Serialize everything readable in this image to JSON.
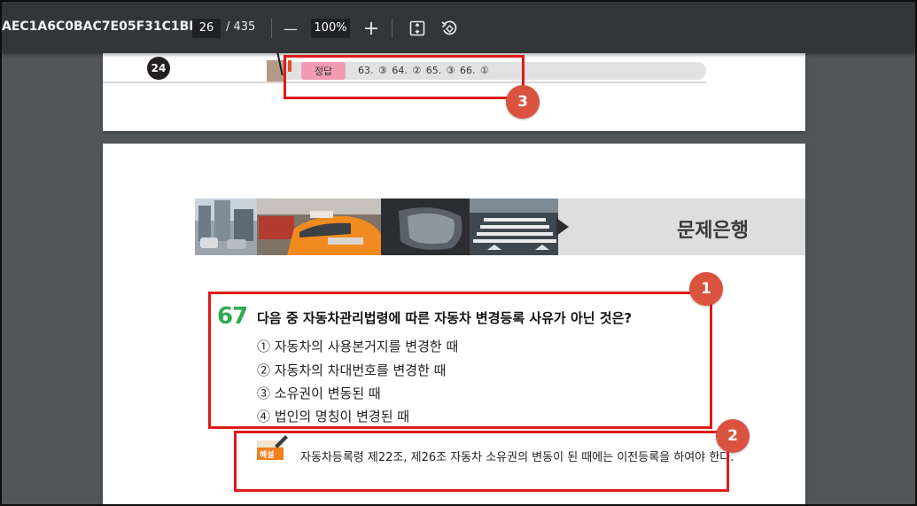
{
  "toolbar": {
    "doc_title": "AEC1A6C0BAC7E05F31C1BE...",
    "page_current": "26",
    "page_total": "/ 435",
    "zoom": "100%",
    "zoom_out_symbol": "—",
    "zoom_in_symbol": "+",
    "icons": [
      "fit-page-icon",
      "rotate-icon"
    ]
  },
  "prev_page": {
    "page_number": "24",
    "answer_label": "정답",
    "answers": "63. ③   64. ②   65. ③   66. ①"
  },
  "current_page": {
    "section_title": "문제은행",
    "question_number": "67",
    "question_text": "다음 중 자동차관리법령에 따른 자동차 변경등록 사유가 아닌 것은?",
    "options": [
      "① 자동차의 사용본거지를 변경한 때",
      "② 자동차의 차대번호를 변경한 때",
      "③ 소유권이 변동된 때",
      "④ 법인의 명칭이 변경된 때"
    ],
    "solution_badge": "해설",
    "solution_text": "자동차등록령 제22조, 제26조 자동차 소유권의 변동이 된 때에는 이전등록을 하여야 한다."
  },
  "annotations": {
    "labels": [
      "1",
      "2",
      "3"
    ],
    "box_color": "#e01a1a",
    "badge_color": "#d9533f"
  },
  "colors": {
    "toolbar_bg": "#323639",
    "viewer_bg": "#525659",
    "question_number": "#2eab4f",
    "answer_label_bg": "#f29cb4",
    "solution_badge": "#f07f1e"
  }
}
